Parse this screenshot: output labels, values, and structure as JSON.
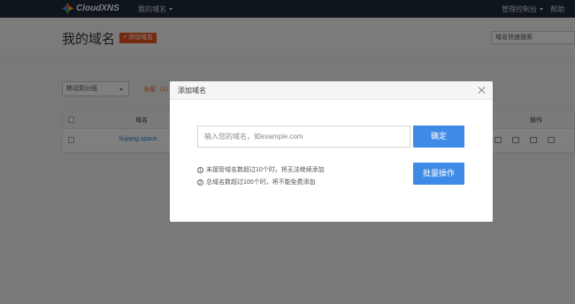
{
  "topbar": {
    "brand": "CloudXNS",
    "nav_domains": "我的域名",
    "nav_console": "管理控制台",
    "nav_help": "帮助"
  },
  "header": {
    "title": "我的域名",
    "add_button": "+ 添加域名",
    "search_placeholder": "域名快速搜索"
  },
  "toolbar": {
    "move_group": "移动到分组",
    "filter_all": "全部（1）"
  },
  "table": {
    "columns": {
      "domain": "域名",
      "actions": "操作"
    },
    "rows": [
      {
        "domain": "liujiang.space."
      }
    ]
  },
  "modal": {
    "title": "添加域名",
    "input_placeholder": "输入您的域名，如example.com",
    "confirm_label": "确定",
    "notes": [
      {
        "num": "1",
        "text": "未接管域名数超过10个时，将无法继续添加"
      },
      {
        "num": "2",
        "text": "总域名数超过100个时，将不能免费添加"
      }
    ],
    "batch_label": "批量操作"
  },
  "colors": {
    "nav_bg": "#1f2a3a",
    "accent_orange": "#e8541f",
    "primary_blue": "#3e8be7",
    "link_blue": "#2b7bd6"
  }
}
